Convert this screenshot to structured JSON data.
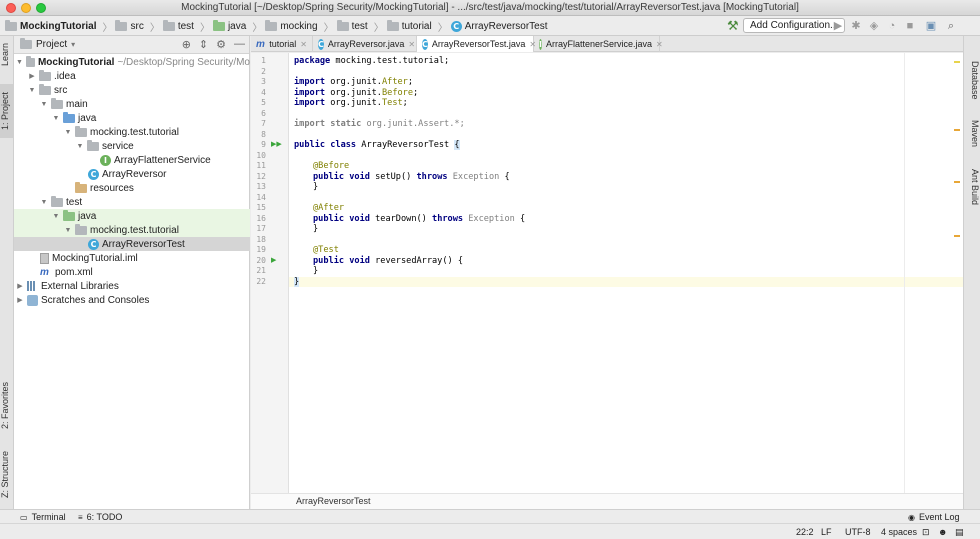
{
  "window": {
    "title": "MockingTutorial [~/Desktop/Spring Security/MockingTutorial] - .../src/test/java/mocking/test/tutorial/ArrayReversorTest.java [MockingTutorial]"
  },
  "breadcrumbs": [
    "MockingTutorial",
    "src",
    "test",
    "java",
    "mocking",
    "test",
    "tutorial",
    "ArrayReversorTest"
  ],
  "toolbar": {
    "add_configuration": "Add Configuration..."
  },
  "left_strip": {
    "learn": "Learn",
    "project": "1: Project",
    "favorites": "2: Favorites",
    "structure": "Z: Structure"
  },
  "right_strip": {
    "database": "Database",
    "maven": "Maven",
    "ant": "Ant Build"
  },
  "project_panel": {
    "title": "Project",
    "tree": [
      {
        "label": "MockingTutorial",
        "extra": "~/Desktop/Spring Security/Mo",
        "bold": true
      },
      {
        "label": ".idea"
      },
      {
        "label": "src"
      },
      {
        "label": "main"
      },
      {
        "label": "java"
      },
      {
        "label": "mocking.test.tutorial"
      },
      {
        "label": "service"
      },
      {
        "label": "ArrayFlattenerService"
      },
      {
        "label": "ArrayReversor"
      },
      {
        "label": "resources"
      },
      {
        "label": "test"
      },
      {
        "label": "java"
      },
      {
        "label": "mocking.test.tutorial"
      },
      {
        "label": "ArrayReversorTest"
      },
      {
        "label": "MockingTutorial.iml"
      },
      {
        "label": "pom.xml"
      },
      {
        "label": "External Libraries"
      },
      {
        "label": "Scratches and Consoles"
      }
    ]
  },
  "tabs": [
    {
      "label": "tutorial",
      "icon": "m"
    },
    {
      "label": "ArrayReversor.java",
      "icon": "C"
    },
    {
      "label": "ArrayReversorTest.java",
      "icon": "C"
    },
    {
      "label": "ArrayFlattenerService.java",
      "icon": "I"
    }
  ],
  "editor": {
    "line_numbers": [
      "1",
      "2",
      "3",
      "4",
      "5",
      "6",
      "7",
      "8",
      "9",
      "10",
      "11",
      "12",
      "13",
      "14",
      "15",
      "16",
      "17",
      "18",
      "19",
      "20",
      "21",
      "22"
    ],
    "code": {
      "l1_kw": "package",
      "l1_rest": " mocking.test.tutorial;",
      "import_kw": "import",
      "l3_pkg": " org.junit.",
      "l3_cls": "After",
      "l4_pkg": " org.junit.",
      "l4_cls": "Before",
      "l5_pkg": " org.junit.",
      "l5_cls": "Test",
      "semi": ";",
      "l7_kw": "import static",
      "l7_rest": " org.junit.Assert.*;",
      "l9_kw": "public class",
      "l9_name": " ArrayReversorTest ",
      "l9_brace": "{",
      "l11_ann": "@Before",
      "l12_kw1": "public void",
      "l12_name": " setUp() ",
      "l12_kw2": "throws",
      "l12_exc": " Exception",
      "l12_brace": " {",
      "close_brace": "}",
      "l15_ann": "@After",
      "l16_kw1": "public void",
      "l16_name": " tearDown() ",
      "l16_kw2": "throws",
      "l16_exc": " Exception",
      "l16_brace": " {",
      "l19_ann": "@Test",
      "l20_kw1": "public void",
      "l20_name": " reversedArray() {",
      "l22": "}"
    },
    "breadcrumb": "ArrayReversorTest"
  },
  "bottom_bar": {
    "terminal": "Terminal",
    "todo": "6: TODO",
    "event_log": "Event Log"
  },
  "status_bar": {
    "position": "22:2",
    "line_sep": "LF",
    "encoding": "UTF-8",
    "indent": "4 spaces"
  }
}
